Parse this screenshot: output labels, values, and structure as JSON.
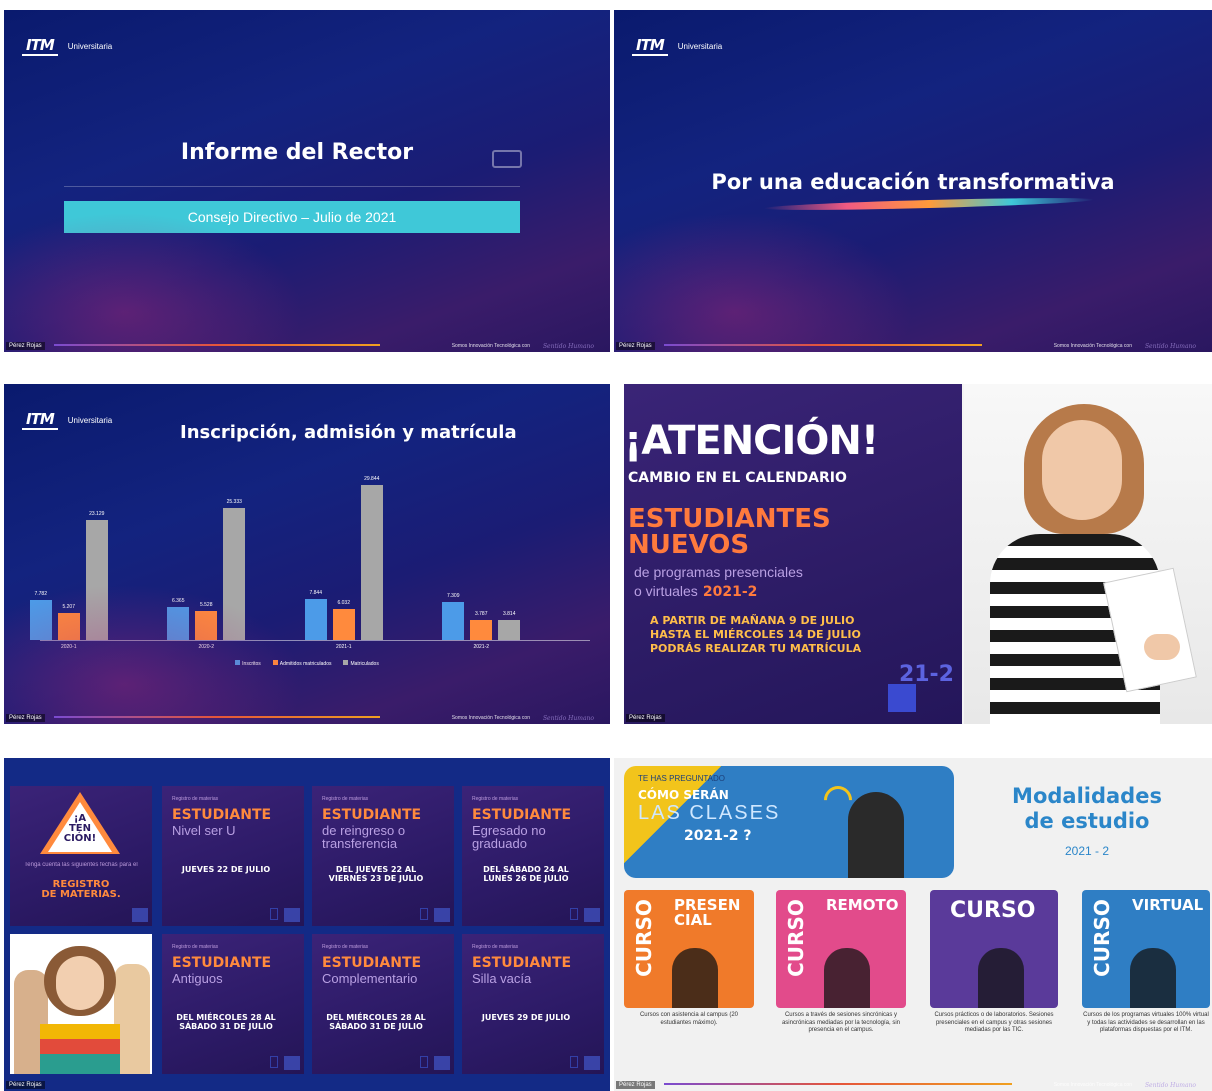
{
  "common": {
    "logo_mark": "ITM",
    "logo_text": "Universitaria",
    "presenter": "Pérez Rojas",
    "slogan": "Somos Innovación Tecnológica con",
    "signature": "Sentido Humano",
    "colors": {
      "navy": "#13237f",
      "orange": "#ff8a3d",
      "cyan": "#3fc8d8",
      "gray": "#a7a7a7",
      "blue": "#4c9be8"
    }
  },
  "slide1": {
    "title": "Informe del Rector",
    "subtitle": "Consejo Directivo – Julio de 2021"
  },
  "slide2": {
    "title": "Por una educación transformativa"
  },
  "slide3": {
    "title": "Inscripción, admisión y matrícula",
    "chart_data": {
      "type": "bar",
      "title": "Inscripción, admisión y matrícula",
      "categories": [
        "2020-1",
        "2020-2",
        "2021-1",
        "2021-2"
      ],
      "series": [
        {
          "name": "Inscritos",
          "color": "#4c9be8",
          "values": [
            7782,
            6365,
            7844,
            7309
          ]
        },
        {
          "name": "Admitidos matriculados",
          "color": "#ff8a3d",
          "values": [
            5207,
            5528,
            6032,
            3787
          ]
        },
        {
          "name": "Matriculados",
          "color": "#a7a7a7",
          "values": [
            23129,
            25333,
            29844,
            3814
          ]
        }
      ],
      "value_labels": [
        [
          "7.782",
          "6.365",
          "7.844",
          "7.309"
        ],
        [
          "5.207",
          "5.528",
          "6.032",
          "3.787"
        ],
        [
          "23.129",
          "25.333",
          "29.844",
          "3.814"
        ]
      ],
      "ylim": [
        0,
        30000
      ],
      "legend": "bottom"
    }
  },
  "slide4": {
    "headline": "¡ATENCIÓN!",
    "subhead": "CAMBIO EN EL CALENDARIO",
    "highlight1": "ESTUDIANTES",
    "highlight2": "NUEVOS",
    "desc1": "de programas presenciales",
    "desc2": "o virtuales",
    "period": "2021-2",
    "line1": "A PARTIR DE MAÑANA 9 DE JULIO",
    "line2": "HASTA EL MIÉRCOLES 14 DE JULIO",
    "line3": "PODRÁS REALIZAR TU MATRÍCULA",
    "tag": "21-2"
  },
  "slide5": {
    "atencion": [
      "¡A",
      "TEN",
      "CIÓN!"
    ],
    "intro": "Tenga cuenta las siguientes fechas para el",
    "registro": "REGISTRO",
    "materias": "DE MATERIAS.",
    "tiles": [
      {
        "small": "Registro de materias",
        "orange": "ESTUDIANTE",
        "violet": "Nivel ser U",
        "date": "JUEVES 22 DE JULIO"
      },
      {
        "small": "Registro de materias",
        "orange": "ESTUDIANTE",
        "violet": "de reingreso o transferencia",
        "date": "DEL JUEVES 22 AL VIERNES 23 DE JULIO"
      },
      {
        "small": "Registro de materias",
        "orange": "ESTUDIANTE",
        "violet": "Egresado no graduado",
        "date": "DEL SÁBADO 24 AL LUNES 26 DE JULIO"
      },
      {
        "small": "Registro de materias",
        "orange": "ESTUDIANTE",
        "violet": "Antiguos",
        "date": "DEL MIÉRCOLES 28 AL SÁBADO 31 DE JULIO"
      },
      {
        "small": "Registro de materias",
        "orange": "ESTUDIANTE",
        "violet": "Complementario",
        "date": "DEL MIÉRCOLES 28 AL SÁBADO 31 DE JULIO"
      },
      {
        "small": "Registro de materias",
        "orange": "ESTUDIANTE",
        "violet": "Silla vacía",
        "date": "JUEVES 29 DE JULIO"
      }
    ]
  },
  "slide6": {
    "question_small": "TE HAS PREGUNTADO",
    "question1": "CÓMO SERÁN",
    "question2": "LAS CLASES",
    "question3": "2021-2 ?",
    "title1": "Modalidades",
    "title2": "de estudio",
    "period": "2021 - 2",
    "cards": [
      {
        "vertical": "CURSO",
        "big": "PRESENCIAL",
        "desc": "Cursos con asistencia al campus (20 estudiantes máximo)."
      },
      {
        "vertical": "CURSO",
        "big": "REMOTO",
        "desc": "Cursos a través de sesiones sincrónicas y asincrónicas mediadas por la tecnología, sin presencia en el campus."
      },
      {
        "vertical": "",
        "big": "CURSO",
        "desc": "Cursos prácticos o de laboratorios. Sesiones presenciales en el campus y otras sesiones mediadas por las TIC."
      },
      {
        "vertical": "CURSO",
        "big": "VIRTUAL",
        "desc": "Cursos de los programas virtuales 100% virtual y todas las actividades se desarrollan en las plataformas dispuestas por el ITM."
      }
    ]
  }
}
